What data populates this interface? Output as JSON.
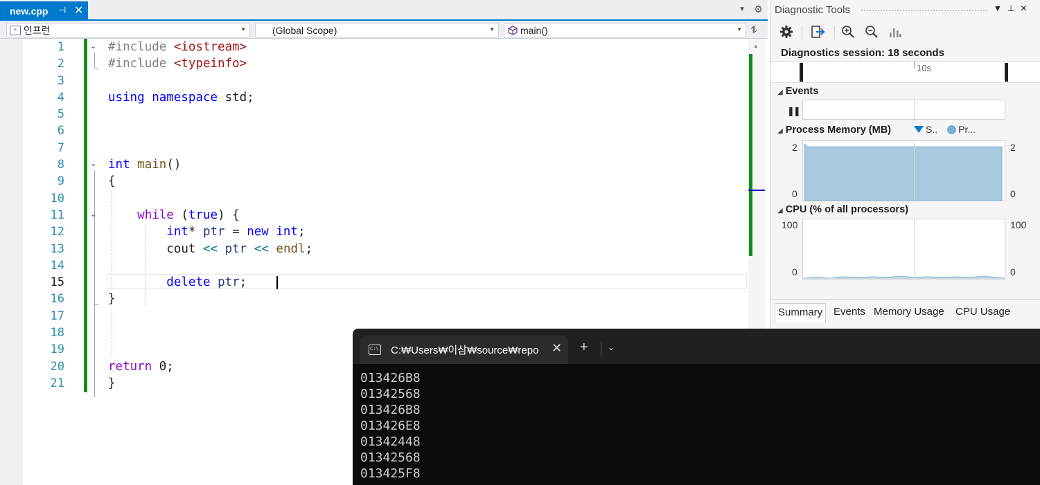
{
  "editor_tab": {
    "filename": "new.cpp",
    "pin_icon": "pin-icon",
    "close_icon": "close-icon"
  },
  "navbar": {
    "project": "인프런",
    "scope": "(Global Scope)",
    "member": "main()"
  },
  "line_numbers": [
    "1",
    "2",
    "3",
    "4",
    "5",
    "6",
    "7",
    "8",
    "9",
    "10",
    "11",
    "12",
    "13",
    "14",
    "15",
    "16",
    "17",
    "18",
    "19",
    "20",
    "21"
  ],
  "current_line": 15,
  "code_lines": [
    [
      {
        "t": "#include ",
        "c": "pp"
      },
      {
        "t": "<iostream>",
        "c": "str"
      }
    ],
    [
      {
        "t": "#include ",
        "c": "pp"
      },
      {
        "t": "<typeinfo>",
        "c": "str"
      }
    ],
    [],
    [
      {
        "t": "using",
        "c": "kw"
      },
      {
        "t": " "
      },
      {
        "t": "namespace",
        "c": "kw"
      },
      {
        "t": " std;"
      }
    ],
    [],
    [],
    [],
    [
      {
        "t": "int",
        "c": "kw"
      },
      {
        "t": " "
      },
      {
        "t": "main",
        "c": "fn"
      },
      {
        "t": "()"
      }
    ],
    [
      {
        "t": "{"
      }
    ],
    [],
    [
      {
        "t": "    "
      },
      {
        "t": "while",
        "c": "ctl"
      },
      {
        "t": " ("
      },
      {
        "t": "true",
        "c": "kw"
      },
      {
        "t": ") {"
      }
    ],
    [
      {
        "t": "        "
      },
      {
        "t": "int",
        "c": "kw"
      },
      {
        "t": "* "
      },
      {
        "t": "ptr",
        "c": "id"
      },
      {
        "t": " = "
      },
      {
        "t": "new",
        "c": "kw"
      },
      {
        "t": " "
      },
      {
        "t": "int",
        "c": "kw"
      },
      {
        "t": ";"
      }
    ],
    [
      {
        "t": "        "
      },
      {
        "t": "cout"
      },
      {
        "t": " "
      },
      {
        "t": "<<",
        "c": "op"
      },
      {
        "t": " "
      },
      {
        "t": "ptr",
        "c": "id"
      },
      {
        "t": " "
      },
      {
        "t": "<<",
        "c": "op"
      },
      {
        "t": " "
      },
      {
        "t": "endl",
        "c": "fn"
      },
      {
        "t": ";"
      }
    ],
    [],
    [
      {
        "t": "        "
      },
      {
        "t": "delete",
        "c": "kw"
      },
      {
        "t": " "
      },
      {
        "t": "ptr",
        "c": "id"
      },
      {
        "t": "; "
      }
    ],
    [
      {
        "t": "}"
      }
    ],
    [],
    [],
    [],
    [
      {
        "t": "return",
        "c": "ctl"
      },
      {
        "t": " 0;"
      }
    ],
    [
      {
        "t": "}"
      }
    ]
  ],
  "diagnostics": {
    "title": "Diagnostic Tools",
    "session": "Diagnostics session: 18 seconds",
    "timeline_tick": "10s",
    "events_title": "Events",
    "memory_title": "Process Memory (MB)",
    "memory_legend": [
      "S..",
      "Pr..."
    ],
    "memory_axis": {
      "top_left": "2",
      "bottom_left": "0",
      "top_right": "2",
      "bottom_right": "0"
    },
    "memory_level": 1.9,
    "memory_max": 2,
    "cpu_title": "CPU (% of all processors)",
    "cpu_axis": {
      "top_left": "100",
      "bottom_left": "0",
      "top_right": "100",
      "bottom_right": "0"
    },
    "tabs": [
      "Summary",
      "Events",
      "Memory Usage",
      "CPU Usage"
    ],
    "active_tab": "Summary",
    "colors": {
      "memory_fill": "#a8c9de",
      "memory_line": "#7fb0d0",
      "legend_snapshot": "#007acc"
    }
  },
  "terminal": {
    "tab_title": "C:₩Users₩이삼₩source₩repo",
    "new_tab_label": "+",
    "output": [
      "013426B8",
      "01342568",
      "013426B8",
      "013426E8",
      "01342448",
      "01342568",
      "013425F8"
    ]
  },
  "colors": {
    "accent": "#007acc",
    "change_bar": "#108d20",
    "terminal_bg": "#0c0c0c"
  }
}
